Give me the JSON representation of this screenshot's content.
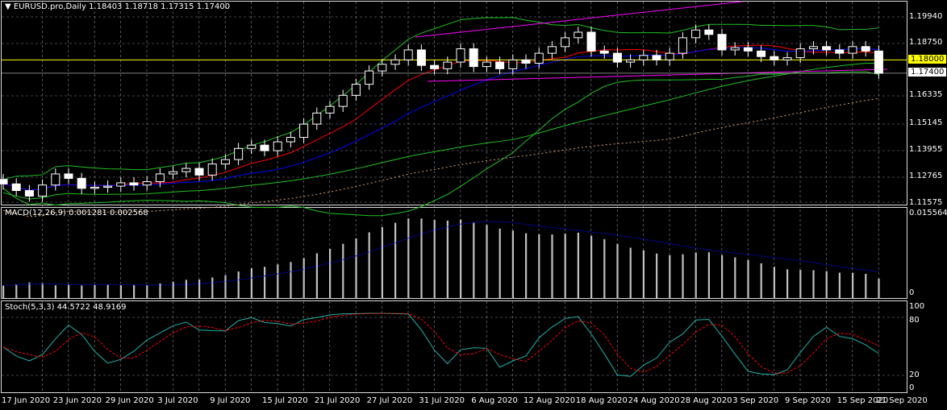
{
  "header": {
    "menu_icon": "triangle-down-icon",
    "symbol": "EURUSD.pro,Daily",
    "open": "1.18403",
    "high": "1.18718",
    "low": "1.17315",
    "close": "1.17400"
  },
  "price_axis": [
    "1.19940",
    "1.18750",
    "1.16335",
    "1.15145",
    "1.13955",
    "1.12765",
    "1.11575"
  ],
  "price_tags": {
    "yellow_line": "1.18000",
    "current": "1.17400"
  },
  "macd": {
    "label": "MACD(12,26,9) 0.001281 0.002568",
    "axis_max": "0.015564",
    "axis_zero": "0"
  },
  "stoch": {
    "label": "Stoch(5,3,3) 44.5722 48.9169",
    "axis": [
      "100",
      "80",
      "20",
      "0"
    ]
  },
  "dates": [
    {
      "i": 0,
      "t": "17 Jun 2020"
    },
    {
      "i": 4,
      "t": "23 Jun 2020"
    },
    {
      "i": 8,
      "t": "29 Jun 2020"
    },
    {
      "i": 12,
      "t": "3 Jul 2020"
    },
    {
      "i": 16,
      "t": "9 Jul 2020"
    },
    {
      "i": 20,
      "t": "15 Jul 2020"
    },
    {
      "i": 24,
      "t": "21 Jul 2020"
    },
    {
      "i": 28,
      "t": "27 Jul 2020"
    },
    {
      "i": 32,
      "t": "31 Jul 2020"
    },
    {
      "i": 36,
      "t": "6 Aug 2020"
    },
    {
      "i": 40,
      "t": "12 Aug 2020"
    },
    {
      "i": 44,
      "t": "18 Aug 2020"
    },
    {
      "i": 48,
      "t": "24 Aug 2020"
    },
    {
      "i": 52,
      "t": "28 Aug 2020"
    },
    {
      "i": 56,
      "t": "3 Sep 2020"
    },
    {
      "i": 60,
      "t": "9 Sep 2020"
    },
    {
      "i": 64,
      "t": "15 Sep 2020"
    },
    {
      "i": 67,
      "t": "21 Sep 2020"
    }
  ],
  "colors": {
    "bg": "#000000",
    "grid": "#8a8a9a",
    "candle": "#ffffff",
    "ma_fast": "#ff0000",
    "ma_slow": "#0000ff",
    "bands": "#22c022",
    "channel": "#ff00ff",
    "hline": "#ffff00",
    "macd_hist": "#c0c0c0",
    "macd_signal": "#0000ff",
    "stoch_main": "#20b2aa",
    "stoch_signal": "#ff0000"
  },
  "chart_data": {
    "type": "candlestick",
    "price_range": [
      1.11575,
      1.1994
    ],
    "hline": 1.18,
    "closes": [
      1.124,
      1.121,
      1.1185,
      1.1235,
      1.1285,
      1.1265,
      1.122,
      1.1225,
      1.123,
      1.1245,
      1.1235,
      1.125,
      1.1285,
      1.1295,
      1.131,
      1.128,
      1.133,
      1.135,
      1.14,
      1.1415,
      1.139,
      1.143,
      1.145,
      1.151,
      1.156,
      1.159,
      1.164,
      1.169,
      1.175,
      1.178,
      1.18,
      1.1845,
      1.1775,
      1.176,
      1.179,
      1.185,
      1.177,
      1.179,
      1.176,
      1.18,
      1.1785,
      1.183,
      1.186,
      1.19,
      1.1925,
      1.184,
      1.183,
      1.179,
      1.18,
      1.182,
      1.18,
      1.183,
      1.19,
      1.1935,
      1.1915,
      1.1845,
      1.1855,
      1.184,
      1.1815,
      1.18,
      1.181,
      1.185,
      1.186,
      1.1845,
      1.183,
      1.186,
      1.184,
      1.174
    ],
    "macd_max": 0.015564
  }
}
